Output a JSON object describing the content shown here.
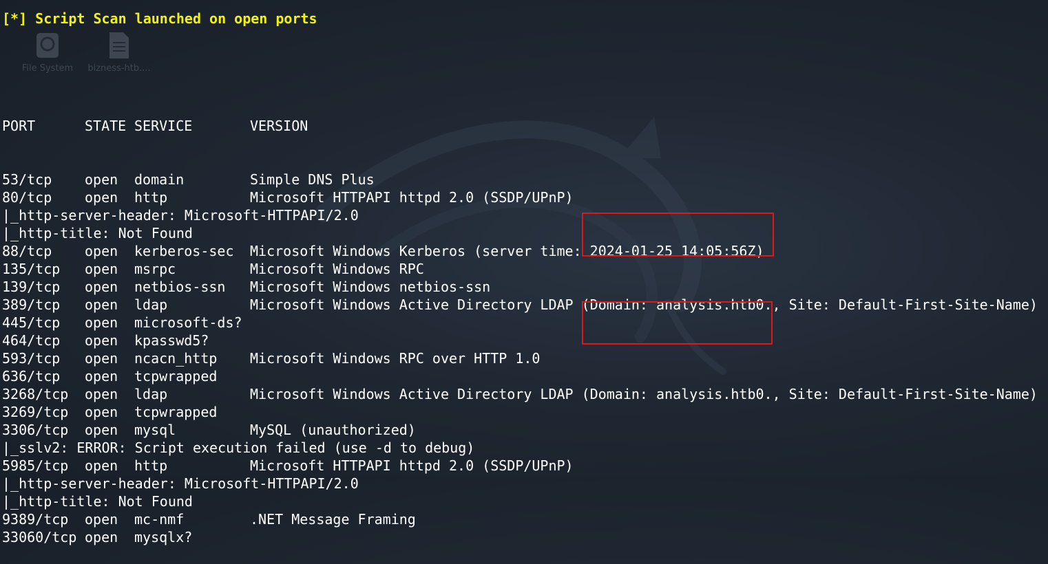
{
  "banner": "[*] Script Scan launched on open ports",
  "desktop_icons": [
    {
      "label": "File System",
      "icon": "drive-icon"
    },
    {
      "label": "bizness-htb....",
      "icon": "document-icon"
    }
  ],
  "table": {
    "headers": {
      "port": "PORT",
      "state": "STATE",
      "service": "SERVICE",
      "version": "VERSION"
    },
    "lines": [
      {
        "type": "row",
        "port": "53/tcp",
        "state": "open",
        "service": "domain",
        "version": "Simple DNS Plus"
      },
      {
        "type": "row",
        "port": "80/tcp",
        "state": "open",
        "service": "http",
        "version": "Microsoft HTTPAPI httpd 2.0 (SSDP/UPnP)"
      },
      {
        "type": "script",
        "text": "|_http-server-header: Microsoft-HTTPAPI/2.0"
      },
      {
        "type": "script",
        "text": "|_http-title: Not Found"
      },
      {
        "type": "row",
        "port": "88/tcp",
        "state": "open",
        "service": "kerberos-sec",
        "version": "Microsoft Windows Kerberos (server time: 2024-01-25 14:05:56Z)"
      },
      {
        "type": "row",
        "port": "135/tcp",
        "state": "open",
        "service": "msrpc",
        "version": "Microsoft Windows RPC"
      },
      {
        "type": "row",
        "port": "139/tcp",
        "state": "open",
        "service": "netbios-ssn",
        "version": "Microsoft Windows netbios-ssn"
      },
      {
        "type": "row",
        "port": "389/tcp",
        "state": "open",
        "service": "ldap",
        "version": "Microsoft Windows Active Directory LDAP (Domain: analysis.htb0., Site: Default-First-Site-Name)"
      },
      {
        "type": "row",
        "port": "445/tcp",
        "state": "open",
        "service": "microsoft-ds?",
        "version": ""
      },
      {
        "type": "row",
        "port": "464/tcp",
        "state": "open",
        "service": "kpasswd5?",
        "version": ""
      },
      {
        "type": "row",
        "port": "593/tcp",
        "state": "open",
        "service": "ncacn_http",
        "version": "Microsoft Windows RPC over HTTP 1.0"
      },
      {
        "type": "row",
        "port": "636/tcp",
        "state": "open",
        "service": "tcpwrapped",
        "version": ""
      },
      {
        "type": "row",
        "port": "3268/tcp",
        "state": "open",
        "service": "ldap",
        "version": "Microsoft Windows Active Directory LDAP (Domain: analysis.htb0., Site: Default-First-Site-Name)"
      },
      {
        "type": "row",
        "port": "3269/tcp",
        "state": "open",
        "service": "tcpwrapped",
        "version": ""
      },
      {
        "type": "row",
        "port": "3306/tcp",
        "state": "open",
        "service": "mysql",
        "version": "MySQL (unauthorized)"
      },
      {
        "type": "script",
        "text": "|_sslv2: ERROR: Script execution failed (use -d to debug)"
      },
      {
        "type": "row",
        "port": "5985/tcp",
        "state": "open",
        "service": "http",
        "version": "Microsoft HTTPAPI httpd 2.0 (SSDP/UPnP)"
      },
      {
        "type": "script",
        "text": "|_http-server-header: Microsoft-HTTPAPI/2.0"
      },
      {
        "type": "script",
        "text": "|_http-title: Not Found"
      },
      {
        "type": "row",
        "port": "9389/tcp",
        "state": "open",
        "service": "mc-nmf",
        "version": ".NET Message Framing"
      },
      {
        "type": "row",
        "port": "33060/tcp",
        "state": "open",
        "service": "mysqlx?",
        "version": ""
      }
    ]
  },
  "colors": {
    "background": "#1f2732",
    "text": "#ffffff",
    "banner": "#f2f20a",
    "highlight_box": "#e01818"
  }
}
